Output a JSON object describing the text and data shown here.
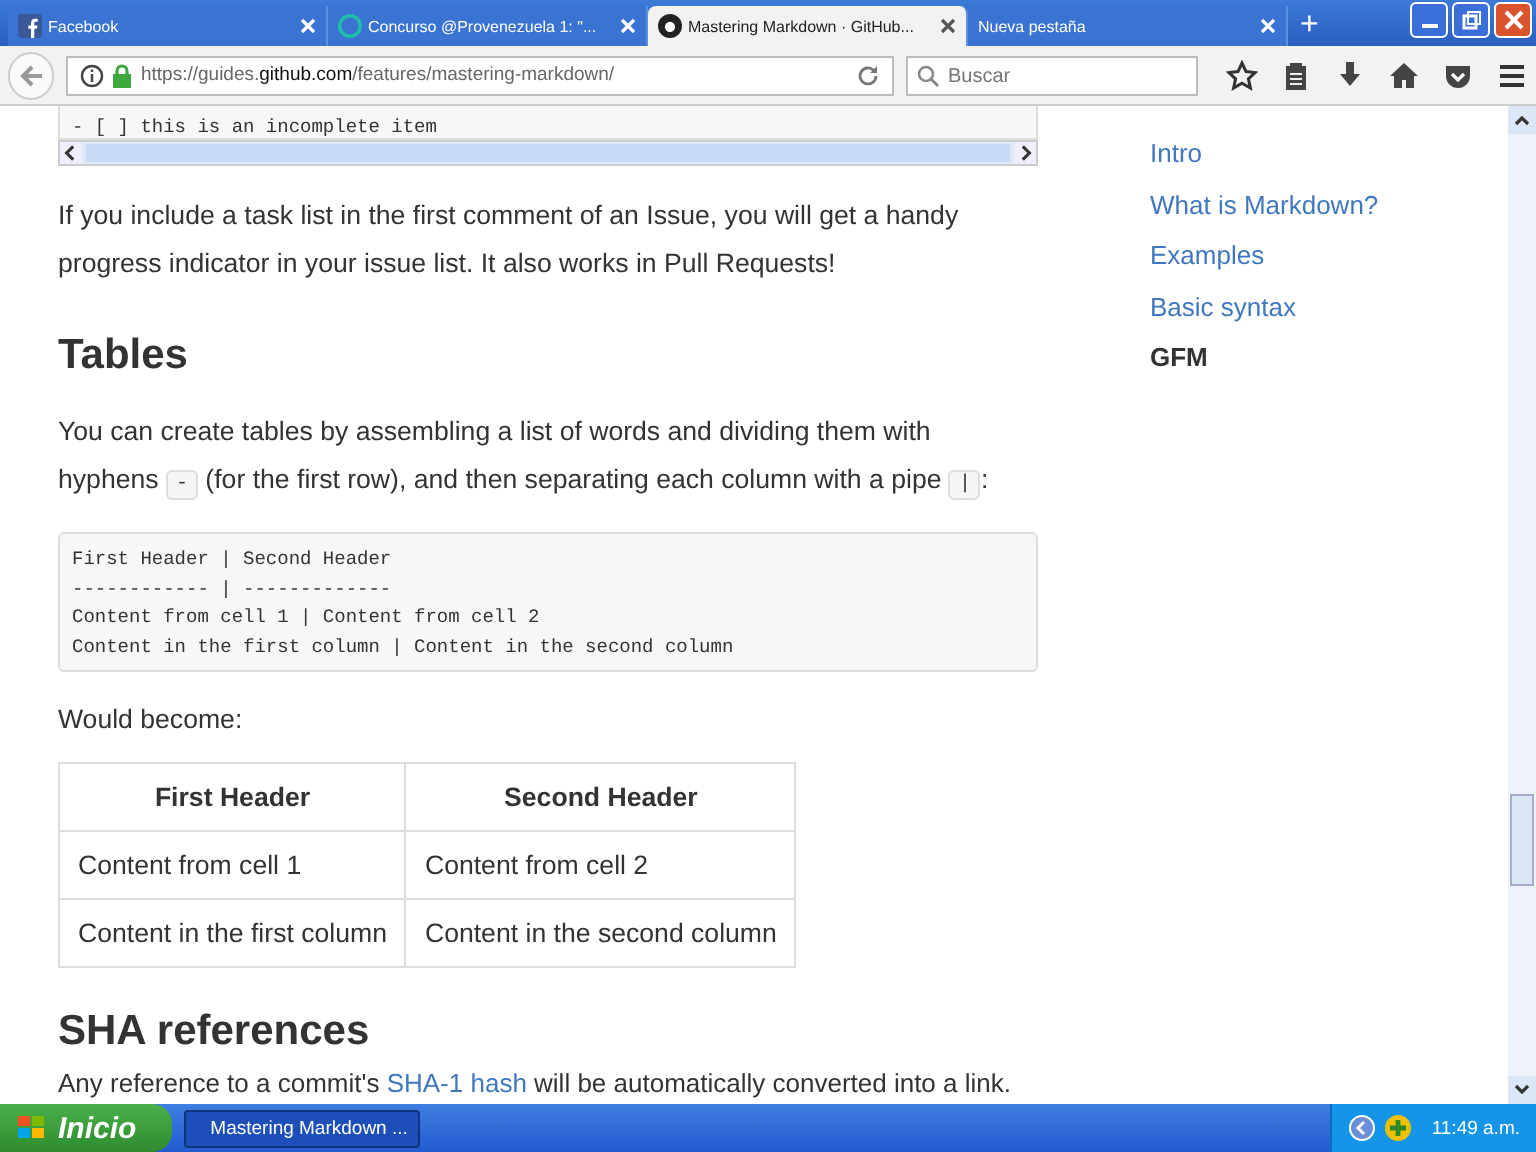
{
  "browser": {
    "tabs": [
      {
        "title": "Facebook",
        "selected": false
      },
      {
        "title": "Concurso @Provenezuela 1: \"...",
        "selected": false
      },
      {
        "title": "Mastering Markdown · GitHub...",
        "selected": true
      },
      {
        "title": "Nueva pestaña",
        "selected": false
      }
    ],
    "new_tab": "+",
    "url": {
      "prefix": "https://guides.",
      "domain": "github.com",
      "path": "/features/mastering-markdown/"
    },
    "search": {
      "placeholder": "Buscar"
    }
  },
  "article": {
    "code_top": "- [ ] this is an incomplete item",
    "para1": "If you include a task list in the first comment of an Issue, you will get a handy progress indicator in your issue list. It also works in Pull Requests!",
    "heading1": "Tables",
    "para2": [
      {
        "kind": "text",
        "text": "You can create tables by assembling a list of words and dividing them with hyphens "
      },
      {
        "kind": "code",
        "text": "-"
      },
      {
        "kind": "text",
        "text": " (for the first row), and then separating each column with a pipe "
      },
      {
        "kind": "code",
        "text": "|"
      },
      {
        "kind": "text",
        "text": ":"
      }
    ],
    "code_block": [
      "First Header | Second Header",
      "------------ | -------------",
      "Content from cell 1 | Content from cell 2",
      "Content in the first column | Content in the second column"
    ],
    "para3": "Would become:",
    "table": {
      "columns": [
        "First Header",
        "Second Header"
      ],
      "rows": [
        [
          "Content from cell 1",
          "Content from cell 2"
        ],
        [
          "Content in the first column",
          "Content in the second column"
        ]
      ]
    },
    "heading2": "SHA references",
    "para4": [
      {
        "kind": "text",
        "text": "Any reference to a commit's "
      },
      {
        "kind": "link",
        "text": "SHA-1 hash"
      },
      {
        "kind": "text",
        "text": " will be automatically converted into a link."
      }
    ]
  },
  "sidebar": {
    "items": [
      {
        "label": "Intro",
        "selected": false
      },
      {
        "label": "What is Markdown?",
        "selected": false
      },
      {
        "label": "Examples",
        "selected": false
      },
      {
        "label": "Basic syntax",
        "selected": false
      },
      {
        "label": "GFM",
        "selected": true
      }
    ]
  },
  "taskbar": {
    "start": "Inicio",
    "window": "Mastering Markdown ...",
    "clock": "11:49 a.m."
  }
}
